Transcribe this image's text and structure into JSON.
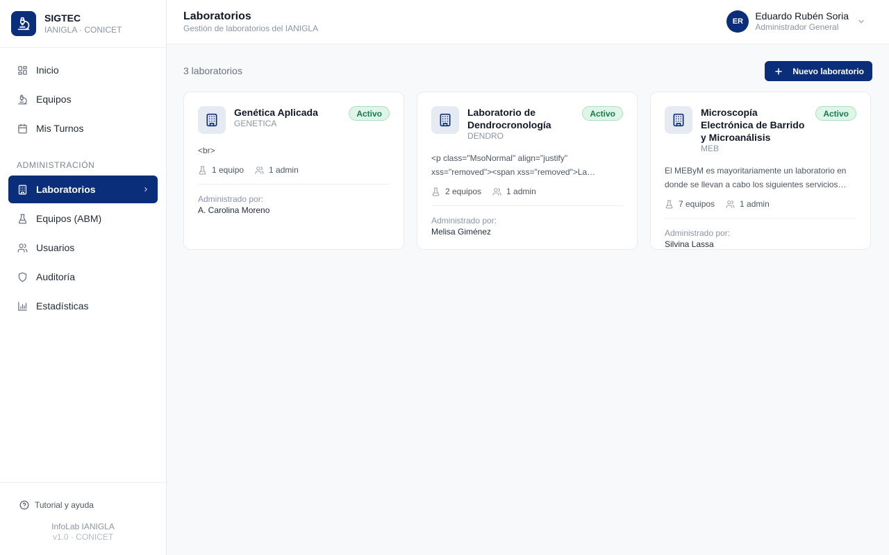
{
  "brand": {
    "title": "SIGTEC",
    "subtitle": "IANIGLA · CONICET"
  },
  "nav": {
    "items": [
      {
        "label": "Inicio",
        "icon": "grid-icon"
      },
      {
        "label": "Equipos",
        "icon": "microscope-icon"
      },
      {
        "label": "Mis Turnos",
        "icon": "calendar-icon"
      }
    ],
    "section_label": "ADMINISTRACIÓN",
    "admin_items": [
      {
        "label": "Laboratorios",
        "icon": "building-icon",
        "active": true
      },
      {
        "label": "Equipos (ABM)",
        "icon": "flask-icon"
      },
      {
        "label": "Usuarios",
        "icon": "users-icon"
      },
      {
        "label": "Auditoría",
        "icon": "shield-icon"
      },
      {
        "label": "Estadísticas",
        "icon": "bar-chart-icon"
      }
    ]
  },
  "footer": {
    "help": "Tutorial y ayuda",
    "app": "InfoLab IANIGLA",
    "version": "v1.0 · CONICET"
  },
  "header": {
    "title": "Laboratorios",
    "subtitle": "Gestión de laboratorios del IANIGLA"
  },
  "user": {
    "initials": "ER",
    "name": "Eduardo Rubén Soria",
    "role": "Administrador General"
  },
  "main": {
    "count": "3 laboratorios",
    "new_button": "Nuevo laboratorio"
  },
  "colors": {
    "primary": "#0b2e7a",
    "badge_bg": "#dff5e8",
    "badge_text": "#18794e"
  },
  "labs": [
    {
      "name": "Genética Aplicada",
      "code": "GENETICA",
      "status": "Activo",
      "description": "<br>",
      "equipos": "1 equipo",
      "admins": "1 admin",
      "admin_label": "Administrado por:",
      "admin_name": "A. Carolina Moreno"
    },
    {
      "name": "Laboratorio de Dendrocronología",
      "code": "DENDRO",
      "status": "Activo",
      "description": "<p class=\"MsoNormal\" align=\"justify\" xss=\"removed\"><span xss=\"removed\">La…",
      "equipos": "2 equipos",
      "admins": "1 admin",
      "admin_label": "Administrado por:",
      "admin_name": "Melisa Giménez"
    },
    {
      "name": "Microscopía Electrónica de Barrido y Microanálisis",
      "code": "MEB",
      "status": "Activo",
      "description": "El MEByM es mayoritariamente un laboratorio en donde se llevan a cabo los siguientes servicios…",
      "equipos": "7 equipos",
      "admins": "1 admin",
      "admin_label": "Administrado por:",
      "admin_name": "Silvina Lassa"
    }
  ]
}
